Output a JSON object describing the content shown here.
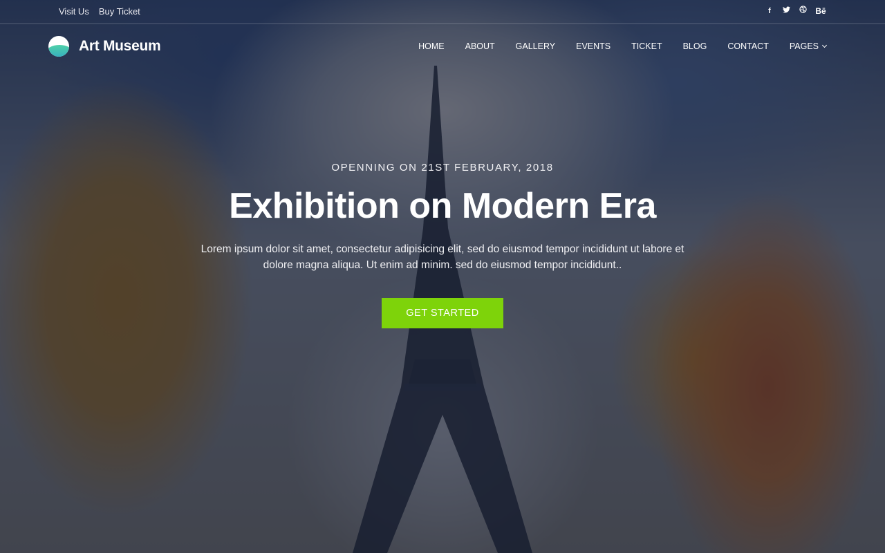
{
  "topbar": {
    "links": [
      "Visit Us",
      "Buy Ticket"
    ],
    "social": [
      {
        "icon": "facebook-icon",
        "glyph": "f"
      },
      {
        "icon": "twitter-icon",
        "glyph": "🐦"
      },
      {
        "icon": "dribbble-icon",
        "glyph": "◎"
      },
      {
        "icon": "behance-icon",
        "glyph": "Bē"
      }
    ]
  },
  "header": {
    "logo_text": "Art Museum",
    "nav": [
      "HOME",
      "ABOUT",
      "GALLERY",
      "EVENTS",
      "TICKET",
      "BLOG",
      "CONTACT",
      "PAGES"
    ]
  },
  "hero": {
    "eyebrow": "OPENNING ON 21ST FEBRUARY, 2018",
    "title": "Exhibition on Modern Era",
    "description": "Lorem ipsum dolor sit amet, consectetur adipisicing elit, sed do eiusmod tempor incididunt ut labore et dolore magna aliqua. Ut enim ad minim. sed do eiusmod tempor incididunt..",
    "cta_label": "GET STARTED"
  },
  "colors": {
    "accent": "#7ed30a",
    "overlay": "#14162a"
  }
}
